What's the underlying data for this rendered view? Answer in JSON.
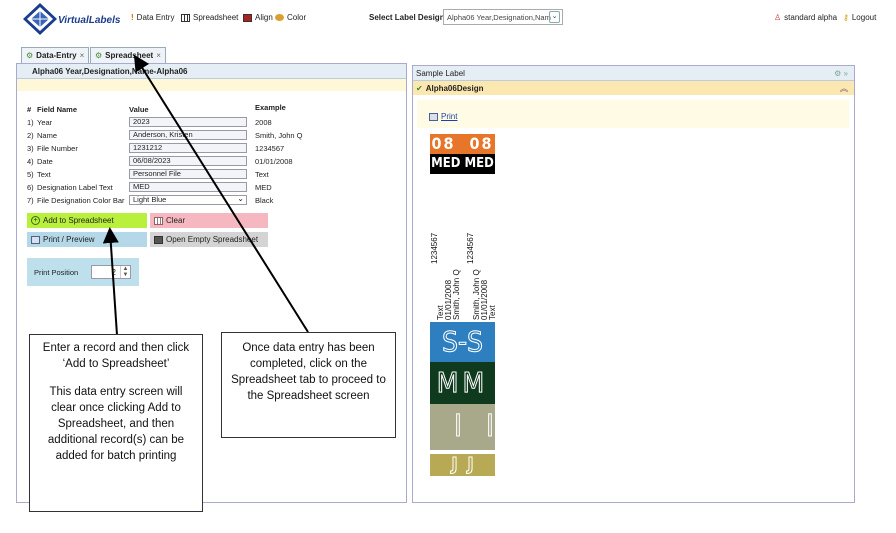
{
  "app": {
    "logo_text": "VirtualLabels"
  },
  "nav": {
    "data_entry": "Data Entry",
    "spreadsheet": "Spreadsheet",
    "align": "Align",
    "color": "Color"
  },
  "design_select": {
    "label": "Select Label Design",
    "value": "Alpha06 Year,Designation,Nam"
  },
  "user": {
    "name": "standard alpha",
    "logout": "Logout"
  },
  "tabs": [
    {
      "label": "Data-Entry",
      "close": "×"
    },
    {
      "label": "Spreadsheet",
      "close": "×"
    }
  ],
  "left_panel": {
    "title": "Alpha06 Year,Designation,Name-Alpha06",
    "headers": {
      "num": "#",
      "field": "Field Name",
      "value": "Value",
      "example": "Example"
    },
    "rows": [
      {
        "num": "1)",
        "field": "Year",
        "value": "2023",
        "example": "2008"
      },
      {
        "num": "2)",
        "field": "Name",
        "value": "Anderson, Kristen",
        "example": "Smith, John Q"
      },
      {
        "num": "3)",
        "field": "File Number",
        "value": "1231212",
        "example": "1234567"
      },
      {
        "num": "4)",
        "field": "Date",
        "value": "06/08/2023",
        "example": "01/01/2008"
      },
      {
        "num": "5)",
        "field": "Text",
        "value": "Personnel File",
        "example": "Text"
      },
      {
        "num": "6)",
        "field": "Designation Label Text",
        "value": "MED",
        "example": "MED"
      },
      {
        "num": "7)",
        "field": "File Designation Color Bar",
        "value": "Light Blue",
        "example": "Black"
      }
    ],
    "buttons": {
      "add": "Add to Spreadsheet",
      "clear": "Clear",
      "print": "Print / Preview",
      "open_empty": "Open Empty Spreadsheet"
    },
    "print_position": {
      "label": "Print Position",
      "value": "2"
    }
  },
  "callouts": {
    "left": [
      "Enter a record and then click ‘Add to Spreadsheet’",
      "This data entry screen will clear once clicking Add to Spreadsheet, and then additional record(s) can be added for batch printing"
    ],
    "right": "Once data entry has been completed, click on the Spreadsheet tab to proceed to the Spreadsheet screen"
  },
  "right_panel": {
    "title": "Sample Label",
    "design_name": "Alpha06Design",
    "print_link": "Print",
    "label": {
      "year_left": "08",
      "year_right": "08",
      "designation_left": "MED",
      "designation_right": "MED",
      "file_number": "1234567",
      "text_line": "Text",
      "date_line": "01/01/2008",
      "name_line": "Smith, John Q",
      "letters": [
        "S",
        "-",
        "S",
        "M",
        "M",
        "I",
        "I",
        "J",
        "J"
      ],
      "colors": {
        "year": "#e8762a",
        "designation": "#000000",
        "s": "#2e7fc0",
        "m": "#0f3a1e",
        "i": "#a8a88a",
        "j": "#b8aa55"
      }
    }
  }
}
